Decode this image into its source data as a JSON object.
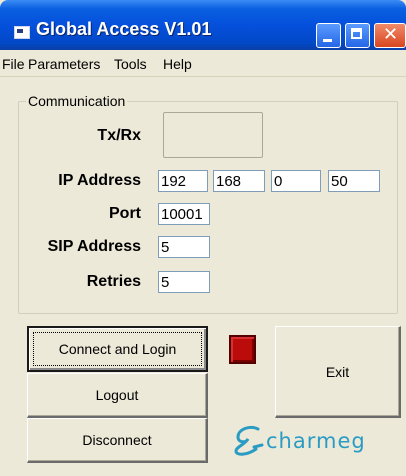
{
  "window": {
    "title": "Global Access V1.01",
    "icons": [
      "app-icon",
      "minimize-icon",
      "maximize-icon",
      "close-icon"
    ]
  },
  "menu": {
    "items": [
      "File",
      "Parameters",
      "Tools",
      "Help"
    ]
  },
  "communication": {
    "group_label": "Communication",
    "txrx_label": "Tx/Rx",
    "ip_label": "IP Address",
    "ip": [
      "192",
      "168",
      "0",
      "50"
    ],
    "port_label": "Port",
    "port": "10001",
    "sip_label": "SIP Address",
    "sip": "5",
    "retries_label": "Retries",
    "retries": "5"
  },
  "actions": {
    "connect_label": "Connect and Login",
    "logout_label": "Logout",
    "disconnect_label": "Disconnect",
    "exit_label": "Exit"
  },
  "status": {
    "led_color": "#bb0c0c"
  },
  "logo": {
    "text": "charmeg",
    "color": "#2a9cc3"
  }
}
